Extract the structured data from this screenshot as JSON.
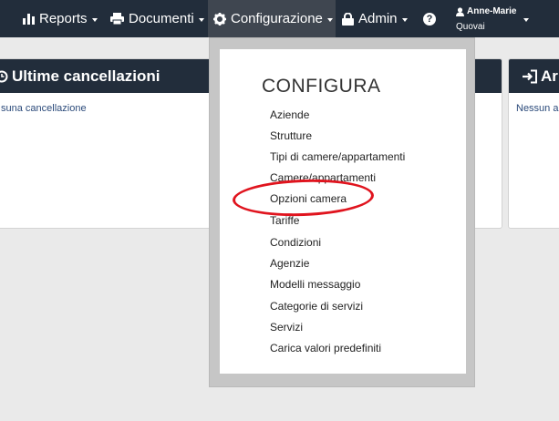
{
  "navbar": {
    "reports": "Reports",
    "documenti": "Documenti",
    "configurazione": "Configurazione",
    "admin": "Admin",
    "help": "?",
    "user_first": "Anne-Marie",
    "user_last": "Quovai"
  },
  "panels": {
    "left_title": "Ultime cancellazioni",
    "left_body": "suna cancellazione",
    "right_title": "Ar",
    "right_body": "Nessun ar"
  },
  "dropdown": {
    "title": "CONFIGURA",
    "items": [
      "Aziende",
      "Strutture",
      "Tipi di camere/appartamenti",
      "Camere/appartamenti",
      "Opzioni camera",
      "Tariffe",
      "Condizioni",
      "Agenzie",
      "Modelli messaggio",
      "Categorie di servizi",
      "Servizi",
      "Carica valori predefiniti"
    ],
    "highlighted": "Opzioni camera"
  },
  "colors": {
    "navbar": "#222d3b",
    "active_tab": "#3f4650",
    "highlight_ring": "#e0141e"
  }
}
